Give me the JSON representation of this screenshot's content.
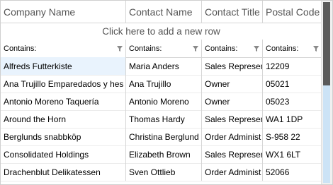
{
  "columns": [
    "Company Name",
    "Contact Name",
    "Contact Title",
    "Postal Code"
  ],
  "new_row_text": "Click here to add a new row",
  "filter_label": "Contains:",
  "rows": [
    [
      "Alfreds Futterkiste",
      "Maria Anders",
      "Sales Represent",
      "12209"
    ],
    [
      "Ana Trujillo Emparedados y hes",
      "Ana Trujillo",
      "Owner",
      "05021"
    ],
    [
      "Antonio Moreno Taquería",
      "Antonio Moreno",
      "Owner",
      "05023"
    ],
    [
      "Around the Horn",
      "Thomas Hardy",
      "Sales Represent",
      "WA1 1DP"
    ],
    [
      "Berglunds snabbköp",
      "Christina Berglund",
      "Order Administ",
      "S-958 22"
    ],
    [
      "Consolidated Holdings",
      "Elizabeth Brown",
      "Sales Represent",
      "WX1 6LT"
    ],
    [
      "Drachenblut Delikatessen",
      "Sven Ottlieb",
      "Order Administ",
      "52066"
    ]
  ],
  "colors": {
    "selected_row": "#e9f3fd",
    "scroll_thumb": "#5b5b5b",
    "scroll_track": "#cce3f6"
  }
}
